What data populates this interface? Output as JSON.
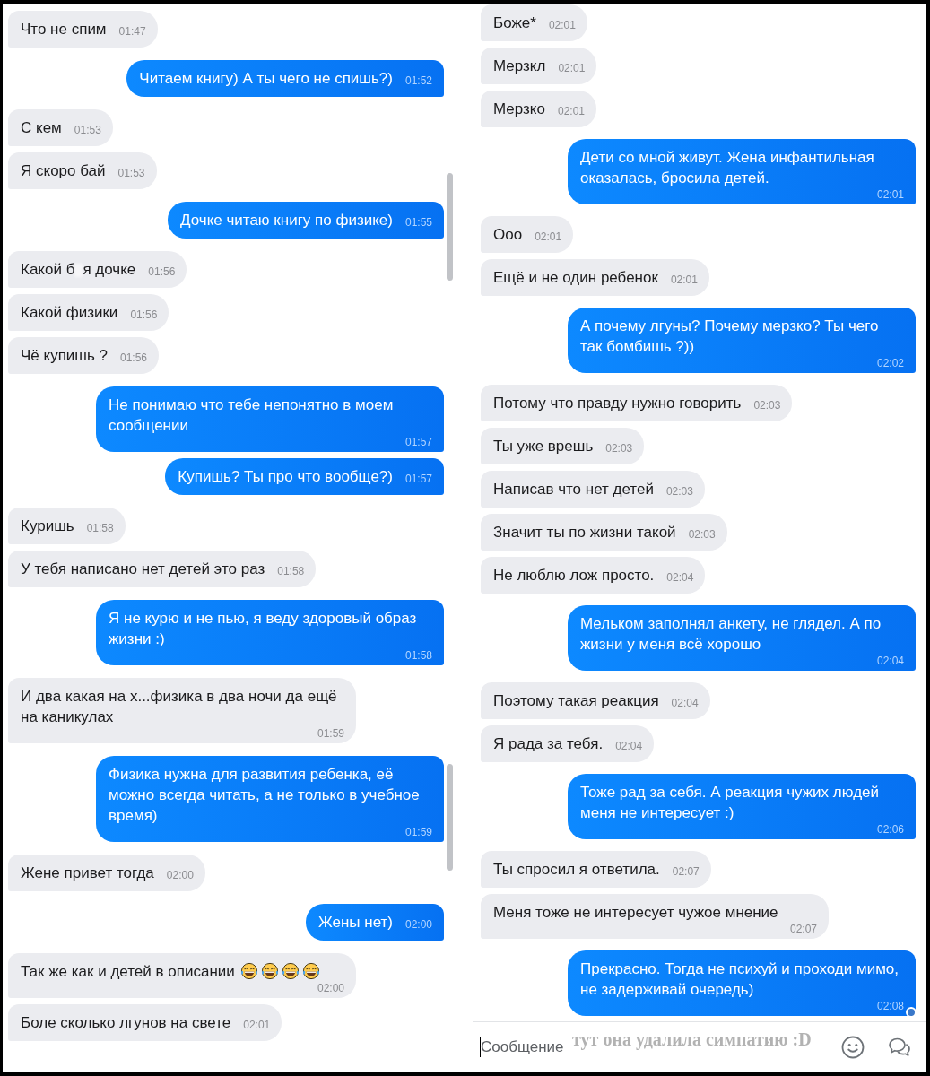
{
  "left_panel": {
    "messages": [
      {
        "kind": "incoming",
        "text": "Что не спим",
        "time": "01:47",
        "seen": false
      },
      {
        "kind": "outgoing",
        "text": "Читаем книгу) А ты чего не спишь?)",
        "time": "01:52",
        "seen": false
      },
      {
        "kind": "incoming",
        "text": "С кем",
        "time": "01:53",
        "seen": false
      },
      {
        "kind": "incoming",
        "text": "Я скоро бай",
        "time": "01:53",
        "seen": false
      },
      {
        "kind": "outgoing",
        "text": "Дочке читаю книгу по физике)",
        "time": "01:55",
        "seen": false
      },
      {
        "kind": "incoming",
        "text": "Какой б",
        "blurred_gap": true,
        "text_after": "я дочке",
        "time": "01:56",
        "seen": false
      },
      {
        "kind": "incoming",
        "text": "Какой физики",
        "time": "01:56",
        "seen": false
      },
      {
        "kind": "incoming",
        "text": "Чё купишь ?",
        "time": "01:56",
        "seen": false
      },
      {
        "kind": "outgoing",
        "text": "Не понимаю что тебе непонятно в моем сообщении",
        "time": "01:57",
        "seen": false
      },
      {
        "kind": "outgoing",
        "text": "Купишь? Ты про что вообще?)",
        "time": "01:57",
        "seen": false
      },
      {
        "kind": "incoming",
        "text": "Куришь",
        "time": "01:58",
        "seen": false
      },
      {
        "kind": "incoming",
        "text": "У тебя написано нет детей это раз",
        "time": "01:58",
        "seen": false
      },
      {
        "kind": "outgoing",
        "text": "Я не курю и не пью, я веду здоровый образ жизни :)",
        "time": "01:58",
        "seen": false
      },
      {
        "kind": "incoming",
        "text": "И два какая на х...физика в два ночи да ещё на каникулах",
        "time": "01:59",
        "seen": false
      },
      {
        "kind": "outgoing",
        "text": "Физика нужна для развития ребенка, её можно всегда читать, а не только в учебное время)",
        "time": "01:59",
        "seen": false
      },
      {
        "kind": "incoming",
        "text": "Жене привет тогда",
        "time": "02:00",
        "seen": false
      },
      {
        "kind": "outgoing",
        "text": "Жены нет)",
        "time": "02:00",
        "seen": false
      },
      {
        "kind": "incoming",
        "text": "Так же как и детей в описании",
        "emoji": [
          {
            "kind": "laughing"
          },
          {
            "kind": "laughing"
          },
          {
            "kind": "laughing"
          },
          {
            "kind": "laughing"
          }
        ],
        "time": "02:00",
        "seen": false
      },
      {
        "kind": "incoming",
        "text": "Боле сколько лгунов на свете",
        "time": "02:01",
        "seen": false
      }
    ]
  },
  "right_panel": {
    "messages": [
      {
        "kind": "incoming",
        "text": "Боже*",
        "time": "02:01",
        "seen": false
      },
      {
        "kind": "incoming",
        "text": "Мерзкл",
        "time": "02:01",
        "seen": false
      },
      {
        "kind": "incoming",
        "text": "Мерзко",
        "time": "02:01",
        "seen": false
      },
      {
        "kind": "outgoing",
        "text": "Дети со мной живут. Жена инфантильная оказалась, бросила детей.",
        "time": "02:01",
        "seen": false
      },
      {
        "kind": "incoming",
        "text": "Ооо",
        "time": "02:01",
        "seen": false
      },
      {
        "kind": "incoming",
        "text": "Ещё и не один ребенок",
        "time": "02:01",
        "seen": false
      },
      {
        "kind": "outgoing",
        "text": "А почему лгуны? Почему мерзко? Ты чего так бомбишь ?))",
        "time": "02:02",
        "seen": false
      },
      {
        "kind": "incoming",
        "text": "Потому что правду нужно говорить",
        "time": "02:03",
        "seen": false
      },
      {
        "kind": "incoming",
        "text": "Ты уже врешь",
        "time": "02:03",
        "seen": false
      },
      {
        "kind": "incoming",
        "text": "Написав что нет детей",
        "time": "02:03",
        "seen": false
      },
      {
        "kind": "incoming",
        "text": "Значит ты по жизни такой",
        "time": "02:03",
        "seen": false
      },
      {
        "kind": "incoming",
        "text": "Не люблю лож просто.",
        "time": "02:04",
        "seen": false
      },
      {
        "kind": "outgoing",
        "text": "Мельком заполнял анкету, не глядел. А по жизни у меня всё хорошо",
        "time": "02:04",
        "seen": false
      },
      {
        "kind": "incoming",
        "text": "Поэтому такая реакция",
        "time": "02:04",
        "seen": false
      },
      {
        "kind": "incoming",
        "text": "Я рада за тебя.",
        "time": "02:04",
        "seen": false
      },
      {
        "kind": "outgoing",
        "text": "Тоже рад за себя. А реакция чужих людей меня не интересует :)",
        "time": "02:06",
        "seen": false
      },
      {
        "kind": "incoming",
        "text": "Ты спросил я ответила.",
        "time": "02:07",
        "seen": false
      },
      {
        "kind": "incoming",
        "text": "Меня тоже не интересует чужое мнение",
        "time": "02:07",
        "seen": false
      },
      {
        "kind": "outgoing",
        "text": "Прекрасно. Тогда не психуй и проходи мимо, не задерживай очередь)",
        "time": "02:08",
        "seen": true
      }
    ],
    "composer": {
      "placeholder": "Сообщение"
    }
  },
  "annotation": "тут она удалила симпатию :D"
}
